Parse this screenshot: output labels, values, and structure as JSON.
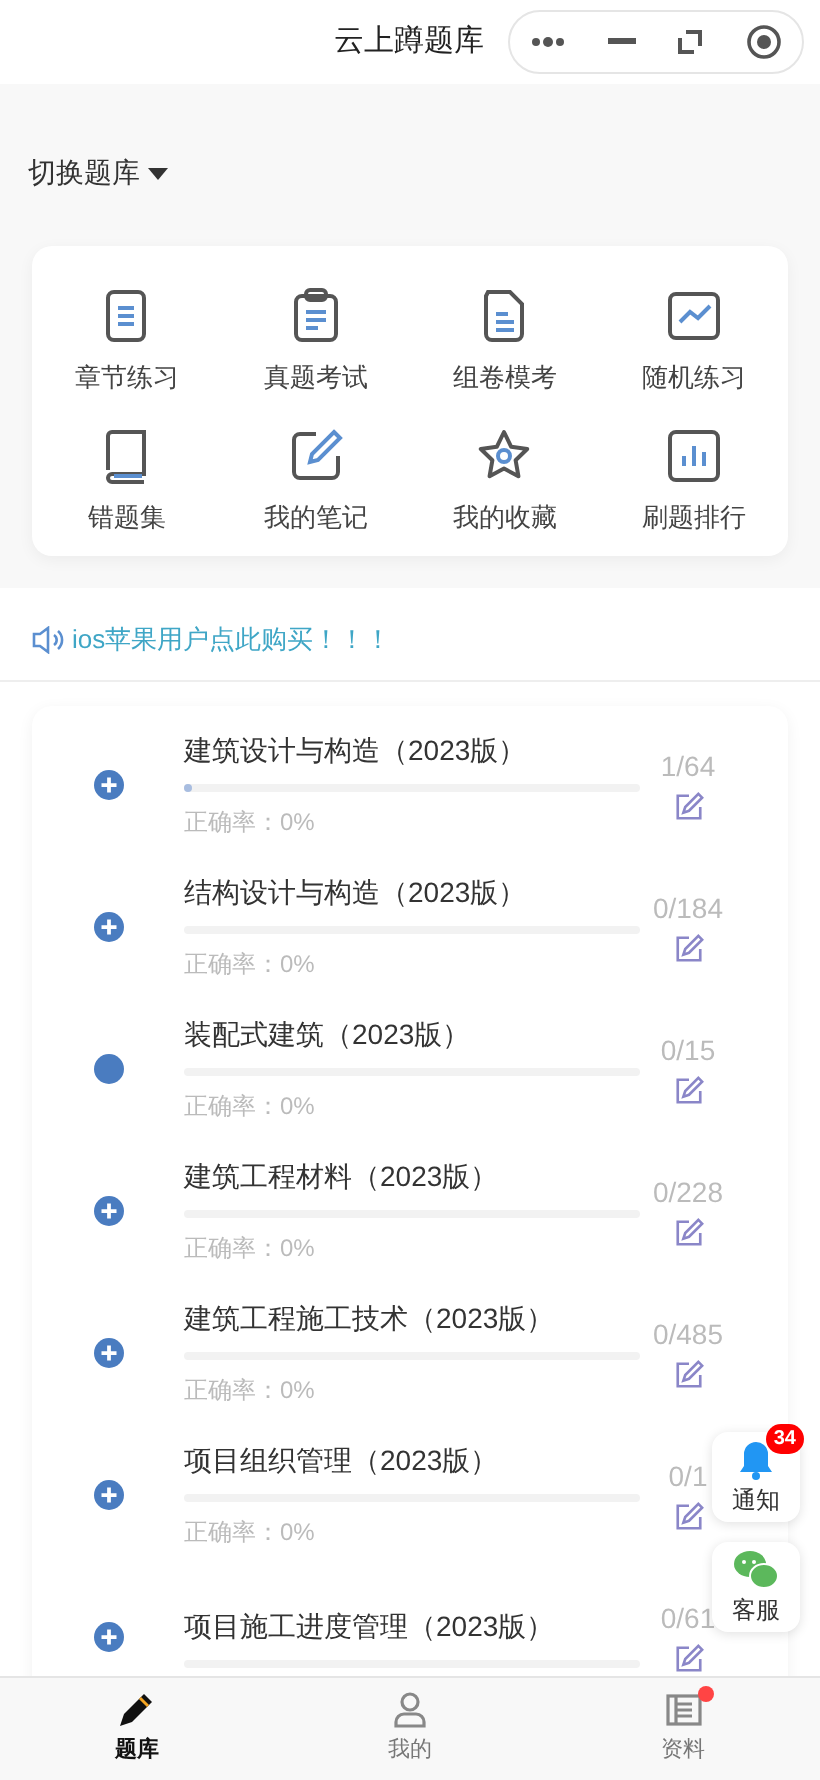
{
  "header": {
    "title": "云上蹲题库"
  },
  "switcher": {
    "label": "切换题库"
  },
  "shortcuts": [
    {
      "label": "章节练习",
      "kind": "doc"
    },
    {
      "label": "真题考试",
      "kind": "clipboard"
    },
    {
      "label": "组卷模考",
      "kind": "file"
    },
    {
      "label": "随机练习",
      "kind": "chart"
    },
    {
      "label": "错题集",
      "kind": "book"
    },
    {
      "label": "我的笔记",
      "kind": "pen"
    },
    {
      "label": "我的收藏",
      "kind": "star"
    },
    {
      "label": "刷题排行",
      "kind": "bars"
    }
  ],
  "notice": {
    "text": "ios苹果用户点此购买！！！"
  },
  "subjects": [
    {
      "title": "建筑设计与构造（2023版）",
      "kind": "plus",
      "level": 0.016,
      "accuracy": "正确率：0%",
      "count": "1/64"
    },
    {
      "title": "结构设计与构造（2023版）",
      "kind": "plus",
      "level": 0,
      "accuracy": "正确率：0%",
      "count": "0/184"
    },
    {
      "title": "装配式建筑（2023版）",
      "kind": "dot",
      "level": 0,
      "accuracy": "正确率：0%",
      "count": "0/15"
    },
    {
      "title": "建筑工程材料（2023版）",
      "kind": "plus",
      "level": 0,
      "accuracy": "正确率：0%",
      "count": "0/228"
    },
    {
      "title": "建筑工程施工技术（2023版）",
      "kind": "plus",
      "level": 0,
      "accuracy": "正确率：0%",
      "count": "0/485"
    },
    {
      "title": "项目组织管理（2023版）",
      "kind": "plus",
      "level": 0,
      "accuracy": "正确率：0%",
      "count": "0/1"
    },
    {
      "title": "项目施工进度管理（2023版）",
      "kind": "plus",
      "level": 0,
      "count": "0/61"
    }
  ],
  "floating": [
    {
      "label": "通知",
      "kind": "bell",
      "badge": "34"
    },
    {
      "label": "客服",
      "kind": "chat"
    }
  ],
  "tabs": [
    {
      "label": "题库",
      "kind": "pencil",
      "selected": true,
      "dot": false
    },
    {
      "label": "我的",
      "kind": "user",
      "selected": false,
      "dot": false
    },
    {
      "label": "资料",
      "kind": "list",
      "selected": false,
      "dot": true
    }
  ]
}
